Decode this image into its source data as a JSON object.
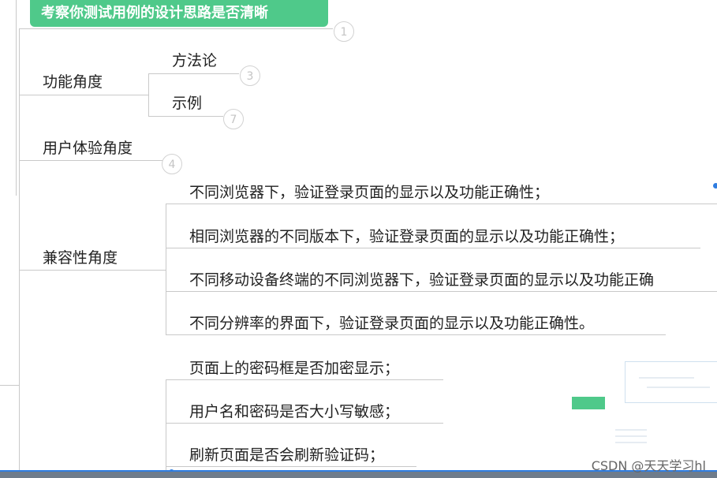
{
  "header": {
    "title": "考察你测试用例的设计思路是否清晰",
    "badge": "1"
  },
  "branches": {
    "functional": {
      "label": "功能角度",
      "children": [
        "方法论",
        "示例"
      ],
      "badges": [
        "3",
        "7"
      ]
    },
    "ux": {
      "label": "用户体验角度",
      "badge": "4"
    },
    "compat": {
      "label": "兼容性角度",
      "items": [
        "不同浏览器下，验证登录页面的显示以及功能正确性；",
        "相同浏览器的不同版本下，验证登录页面的显示以及功能正确性；",
        "不同移动设备终端的不同浏览器下，验证登录页面的显示以及功能正确",
        "不同分辨率的界面下，验证登录页面的显示以及功能正确性。"
      ]
    },
    "security": {
      "items": [
        "页面上的密码框是否加密显示；",
        "用户名和密码是否大小写敏感；",
        "刷新页面是否会刷新验证码；"
      ]
    }
  },
  "watermark": "CSDN @天天学习hl",
  "colors": {
    "accent": "#4fc98a",
    "selection": "#2f7de0",
    "line": "#c9c9c9"
  }
}
